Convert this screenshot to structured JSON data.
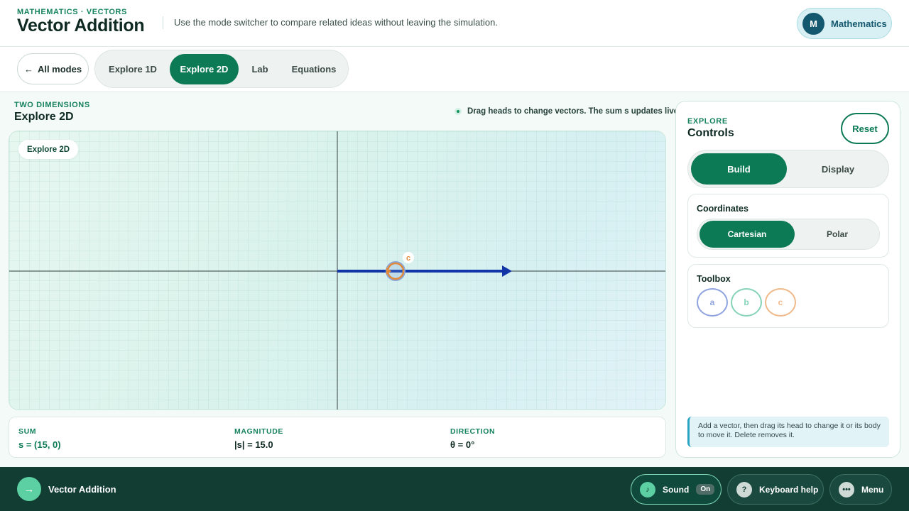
{
  "header": {
    "eyebrow": "MATHEMATICS · VECTORS",
    "title": "Vector Addition",
    "subtitle": "Use the mode switcher to compare related ideas without leaving the simulation.",
    "subject": {
      "avatar_letter": "M",
      "label": "Mathematics"
    }
  },
  "modebar": {
    "back_label": "All modes",
    "back_icon": "arrow-left-icon",
    "tabs": [
      {
        "label": "Explore 1D",
        "active": false
      },
      {
        "label": "Explore 2D",
        "active": true
      },
      {
        "label": "Lab",
        "active": false
      },
      {
        "label": "Equations",
        "active": false
      }
    ]
  },
  "workspace": {
    "eyebrow": "TWO DIMENSIONS",
    "title": "Explore 2D",
    "hint": "Drag heads to change vectors. The sum s updates live.",
    "canvas_badge": "Explore 2D",
    "vector_label": "c",
    "colors": {
      "sum_vector": "#1236a8",
      "vector_c": "#e08a3a",
      "axis": "#556360"
    }
  },
  "readout": {
    "sum": {
      "label": "SUM",
      "value": "s = (15, 0)"
    },
    "magnitude": {
      "label": "MAGNITUDE",
      "value": "|s| = 15.0"
    },
    "direction": {
      "label": "DIRECTION",
      "value": "θ = 0°"
    }
  },
  "controls": {
    "eyebrow": "EXPLORE",
    "title": "Controls",
    "reset_label": "Reset",
    "segments": [
      {
        "label": "Build",
        "active": true
      },
      {
        "label": "Display",
        "active": false
      }
    ],
    "coordinates": {
      "title": "Coordinates",
      "options": [
        {
          "label": "Cartesian",
          "active": true
        },
        {
          "label": "Polar",
          "active": false
        }
      ]
    },
    "toolbox": {
      "title": "Toolbox",
      "tools": [
        {
          "label": "a",
          "color": "#8fa3e0"
        },
        {
          "label": "b",
          "color": "#86d3b8"
        },
        {
          "label": "c",
          "color": "#f0b98a"
        }
      ]
    },
    "note": "Add a vector, then drag its head to change it or its body to move it. Delete removes it."
  },
  "footer": {
    "brand": "Vector Addition",
    "sound": {
      "label": "Sound",
      "state": "On",
      "icon": "music-note-icon"
    },
    "keyboard_help": {
      "label": "Keyboard help",
      "icon": "question-icon"
    },
    "menu": {
      "label": "Menu",
      "icon": "more-icon"
    }
  }
}
